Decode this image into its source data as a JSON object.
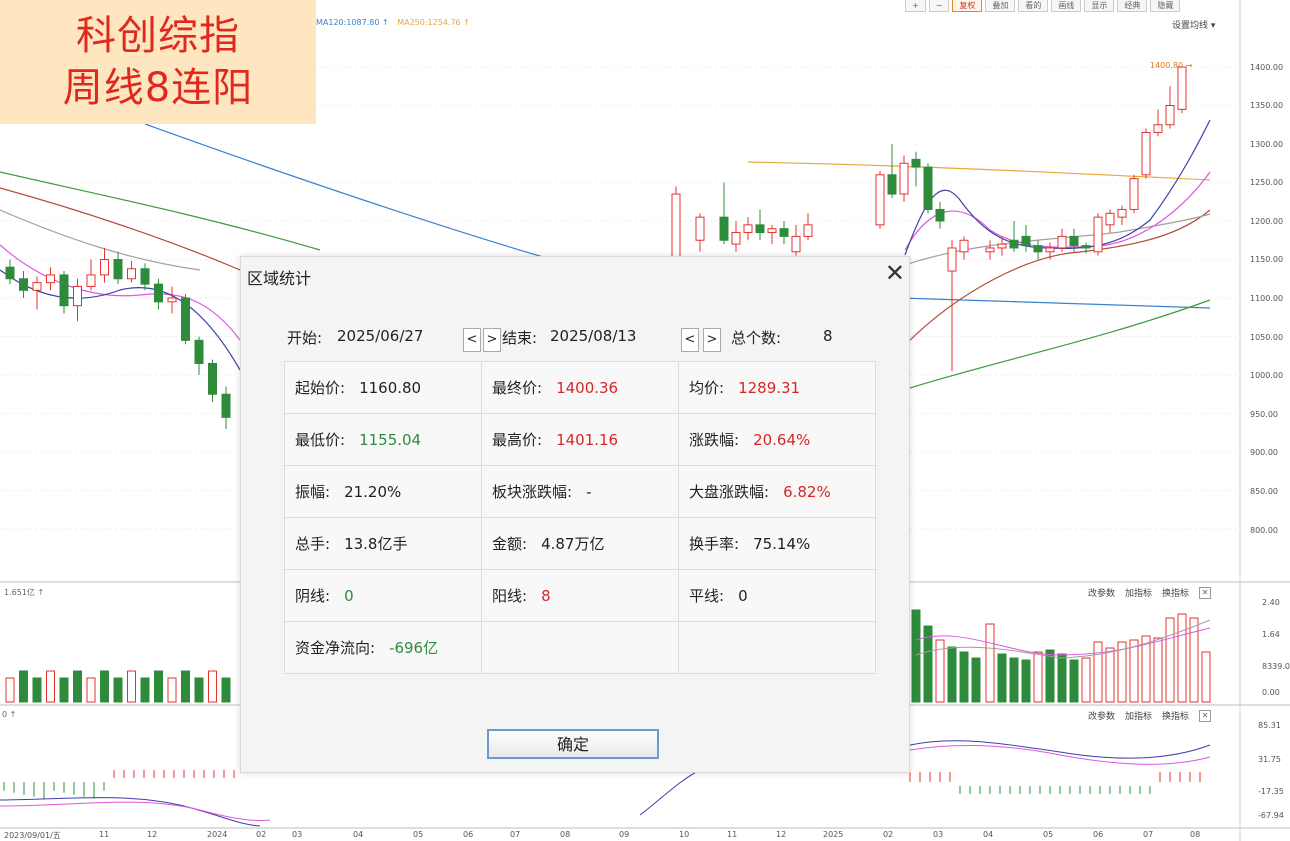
{
  "title_banner": [
    "科创综指",
    "周线8连阳"
  ],
  "toolbar": {
    "buttons": [
      "复权",
      "叠加",
      "看的",
      "画线",
      "显示",
      "经典",
      "隐藏"
    ],
    "active_index": 0
  },
  "ma_legend": {
    "ma120": "MA120:1087.80",
    "ma250": "MA250:1254.76"
  },
  "ma_settings": "设置均线",
  "price_tag": "1400.80",
  "y_price_labels": [
    "1400.00",
    "1350.00",
    "1300.00",
    "1250.00",
    "1200.00",
    "1150.00",
    "1100.00",
    "1050.00",
    "1000.00",
    "950.00",
    "900.00",
    "850.00",
    "800.00"
  ],
  "volume_panel": {
    "label": "1.651亿",
    "y_labels": [
      "2.40",
      "1.64",
      "8339.00",
      "0.00"
    ]
  },
  "macd_panel": {
    "y_labels": [
      "85.31",
      "31.75",
      "-17.35",
      "-67.94"
    ]
  },
  "indicator_buttons": [
    "改参数",
    "加指标",
    "换指标"
  ],
  "x_labels": [
    {
      "t": "2023/09/01/五"
    },
    {
      "t": "11"
    },
    {
      "t": "12"
    },
    {
      "t": "2024"
    },
    {
      "t": "02"
    },
    {
      "t": "03"
    },
    {
      "t": "04"
    },
    {
      "t": "05"
    },
    {
      "t": "06"
    },
    {
      "t": "07"
    },
    {
      "t": "08"
    },
    {
      "t": "09"
    },
    {
      "t": "10"
    },
    {
      "t": "11"
    },
    {
      "t": "12"
    },
    {
      "t": "2025"
    },
    {
      "t": "02"
    },
    {
      "t": "03"
    },
    {
      "t": "04"
    },
    {
      "t": "05"
    },
    {
      "t": "06"
    },
    {
      "t": "07"
    },
    {
      "t": "08"
    }
  ],
  "colors": {
    "up": "#e5322d",
    "down": "#2e8b3c",
    "ma5": "#3f3fa8",
    "ma10": "#e056e0",
    "ma20": "#a0a0a0",
    "ma30": "#b54a3a",
    "ma60": "#3b82d0",
    "ma120": "#3e9b3e",
    "ma250": "#e8a83a"
  },
  "dialog": {
    "title": "区域统计",
    "close": "✕",
    "start_label": "开始:",
    "start_date": "2025/06/27",
    "end_label": "结束:",
    "end_date": "2025/08/13",
    "count_label": "总个数:",
    "count": "8",
    "prev": "<",
    "next": ">",
    "stats": [
      [
        {
          "label": "起始价:",
          "value": "1160.80",
          "color": "black"
        },
        {
          "label": "最终价:",
          "value": "1400.36",
          "color": "red"
        },
        {
          "label": "均价:",
          "value": "1289.31",
          "color": "red"
        }
      ],
      [
        {
          "label": "最低价:",
          "value": "1155.04",
          "color": "green"
        },
        {
          "label": "最高价:",
          "value": "1401.16",
          "color": "red"
        },
        {
          "label": "涨跌幅:",
          "value": "20.64%",
          "color": "red"
        }
      ],
      [
        {
          "label": "振幅:",
          "value": "21.20%",
          "color": "black"
        },
        {
          "label": "板块涨跌幅:",
          "value": "-",
          "color": "black"
        },
        {
          "label": "大盘涨跌幅:",
          "value": "6.82%",
          "color": "red"
        }
      ],
      [
        {
          "label": "总手:",
          "value": "13.8亿手",
          "color": "black"
        },
        {
          "label": "金额:",
          "value": "4.87万亿",
          "color": "black"
        },
        {
          "label": "换手率:",
          "value": "75.14%",
          "color": "black"
        }
      ],
      [
        {
          "label": "阴线:",
          "value": "0",
          "color": "green"
        },
        {
          "label": "阳线:",
          "value": "8",
          "color": "red"
        },
        {
          "label": "平线:",
          "value": "0",
          "color": "black"
        }
      ],
      [
        {
          "label": "资金净流向:",
          "value": "-696亿",
          "color": "green"
        },
        {
          "label": "",
          "value": "",
          "color": "black"
        },
        {
          "label": "",
          "value": "",
          "color": "black"
        }
      ]
    ],
    "ok": "确定"
  },
  "chart_data": {
    "type": "candlestick",
    "candles": [
      {
        "o": 1140,
        "c": 1125,
        "h": 1150,
        "l": 1118
      },
      {
        "o": 1125,
        "c": 1110,
        "h": 1135,
        "l": 1100
      },
      {
        "o": 1110,
        "c": 1120,
        "h": 1128,
        "l": 1085
      },
      {
        "o": 1120,
        "c": 1130,
        "h": 1140,
        "l": 1110
      },
      {
        "o": 1130,
        "c": 1090,
        "h": 1135,
        "l": 1080
      },
      {
        "o": 1090,
        "c": 1115,
        "h": 1125,
        "l": 1070
      },
      {
        "o": 1115,
        "c": 1130,
        "h": 1150,
        "l": 1110
      },
      {
        "o": 1130,
        "c": 1150,
        "h": 1165,
        "l": 1120
      },
      {
        "o": 1150,
        "c": 1125,
        "h": 1160,
        "l": 1118
      },
      {
        "o": 1125,
        "c": 1138,
        "h": 1148,
        "l": 1120
      },
      {
        "o": 1138,
        "c": 1118,
        "h": 1145,
        "l": 1110
      },
      {
        "o": 1118,
        "c": 1095,
        "h": 1125,
        "l": 1085
      },
      {
        "o": 1095,
        "c": 1100,
        "h": 1115,
        "l": 1080
      },
      {
        "o": 1100,
        "c": 1045,
        "h": 1105,
        "l": 1040
      },
      {
        "o": 1045,
        "c": 1015,
        "h": 1050,
        "l": 1000
      },
      {
        "o": 1015,
        "c": 975,
        "h": 1020,
        "l": 965
      },
      {
        "o": 975,
        "c": 945,
        "h": 985,
        "l": 930
      },
      {
        "o": 1140,
        "c": 1235,
        "h": 1245,
        "l": 1130
      },
      {
        "o": 1175,
        "c": 1205,
        "h": 1210,
        "l": 1160
      },
      {
        "o": 1205,
        "c": 1175,
        "h": 1250,
        "l": 1170
      },
      {
        "o": 1170,
        "c": 1185,
        "h": 1200,
        "l": 1160
      },
      {
        "o": 1185,
        "c": 1195,
        "h": 1205,
        "l": 1175
      },
      {
        "o": 1195,
        "c": 1185,
        "h": 1215,
        "l": 1175
      },
      {
        "o": 1185,
        "c": 1190,
        "h": 1195,
        "l": 1170
      },
      {
        "o": 1190,
        "c": 1180,
        "h": 1200,
        "l": 1170
      },
      {
        "o": 1160,
        "c": 1180,
        "h": 1195,
        "l": 1155
      },
      {
        "o": 1180,
        "c": 1195,
        "h": 1210,
        "l": 1175
      },
      {
        "o": 1195,
        "c": 1260,
        "h": 1265,
        "l": 1190
      },
      {
        "o": 1260,
        "c": 1235,
        "h": 1300,
        "l": 1230
      },
      {
        "o": 1235,
        "c": 1275,
        "h": 1285,
        "l": 1225
      },
      {
        "o": 1280,
        "c": 1270,
        "h": 1290,
        "l": 1245
      },
      {
        "o": 1270,
        "c": 1215,
        "h": 1275,
        "l": 1210
      },
      {
        "o": 1215,
        "c": 1200,
        "h": 1225,
        "l": 1190
      },
      {
        "o": 1135,
        "c": 1165,
        "h": 1175,
        "l": 1005
      },
      {
        "o": 1160,
        "c": 1175,
        "h": 1180,
        "l": 1150
      },
      {
        "o": 1160,
        "c": 1165,
        "h": 1175,
        "l": 1150
      },
      {
        "o": 1165,
        "c": 1170,
        "h": 1180,
        "l": 1155
      },
      {
        "o": 1175,
        "c": 1165,
        "h": 1200,
        "l": 1160
      },
      {
        "o": 1180,
        "c": 1168,
        "h": 1195,
        "l": 1160
      },
      {
        "o": 1168,
        "c": 1160,
        "h": 1175,
        "l": 1150
      },
      {
        "o": 1160,
        "c": 1165,
        "h": 1172,
        "l": 1150
      },
      {
        "o": 1165,
        "c": 1180,
        "h": 1190,
        "l": 1160
      },
      {
        "o": 1180,
        "c": 1168,
        "h": 1190,
        "l": 1160
      },
      {
        "o": 1168,
        "c": 1165,
        "h": 1172,
        "l": 1158
      },
      {
        "o": 1160,
        "c": 1205,
        "h": 1210,
        "l": 1155
      },
      {
        "o": 1195,
        "c": 1210,
        "h": 1215,
        "l": 1185
      },
      {
        "o": 1205,
        "c": 1215,
        "h": 1220,
        "l": 1195
      },
      {
        "o": 1215,
        "c": 1255,
        "h": 1260,
        "l": 1210
      },
      {
        "o": 1260,
        "c": 1315,
        "h": 1320,
        "l": 1255
      },
      {
        "o": 1315,
        "c": 1325,
        "h": 1345,
        "l": 1310
      },
      {
        "o": 1325,
        "c": 1350,
        "h": 1375,
        "l": 1320
      },
      {
        "o": 1345,
        "c": 1400,
        "h": 1401,
        "l": 1340
      }
    ]
  }
}
